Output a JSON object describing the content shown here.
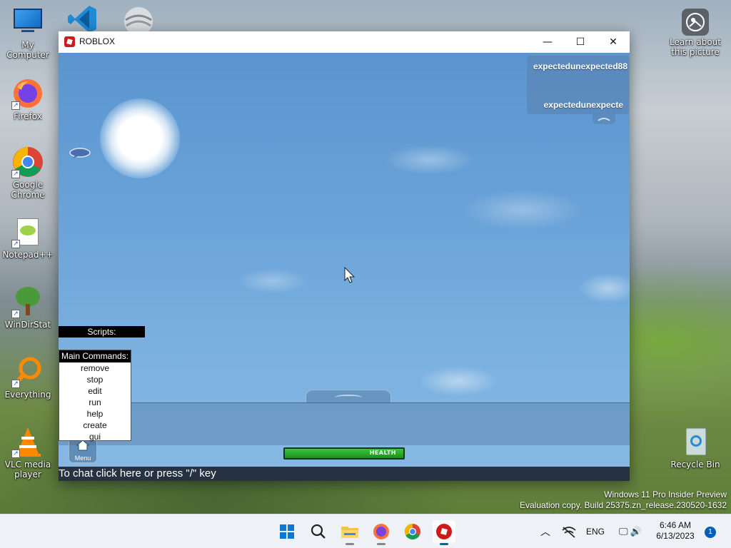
{
  "desktop": {
    "icons": [
      {
        "label": "My Computer",
        "icon": "monitor-icon"
      },
      {
        "label": "Firefox",
        "icon": "firefox-icon"
      },
      {
        "label": "Google Chrome",
        "icon": "chrome-icon"
      },
      {
        "label": "Notepad++",
        "icon": "notepadpp-icon"
      },
      {
        "label": "WinDirStat",
        "icon": "windirstat-icon"
      },
      {
        "label": "Everything",
        "icon": "everything-search-icon"
      },
      {
        "label": "VLC media player",
        "icon": "vlc-icon"
      }
    ],
    "learn_about": "Learn about this picture",
    "recycle_bin": "Recycle Bin",
    "watermark_line1": "Windows 11 Pro Insider Preview",
    "watermark_line2": "Evaluation copy. Build 25375.zn_release.230520-1632"
  },
  "window": {
    "title": "ROBLOX",
    "minimize": "—",
    "maximize": "☐",
    "close": "✕"
  },
  "game": {
    "players": [
      "expectedunexpected88",
      "expectedunexpecte"
    ],
    "scripts_label": "Scripts:",
    "commands": {
      "header": "Main Commands:",
      "items": [
        "remove",
        "stop",
        "edit",
        "run",
        "help",
        "create",
        "gui"
      ]
    },
    "menu_label": "Menu",
    "health_label": "HEALTH",
    "health_fraction": 1.0,
    "chat_hint": "To chat click here or press \"/\" key"
  },
  "taskbar": {
    "apps": [
      "start-icon",
      "search-icon",
      "file-explorer-icon",
      "firefox-icon",
      "chrome-icon",
      "roblox-icon"
    ],
    "language": "ENG",
    "time": "6:46 AM",
    "date": "6/13/2023",
    "notification_count": "1"
  },
  "colors": {
    "roblox_red": "#d01a1a",
    "health_green": "#2fb52f",
    "accent": "#005fb8"
  }
}
